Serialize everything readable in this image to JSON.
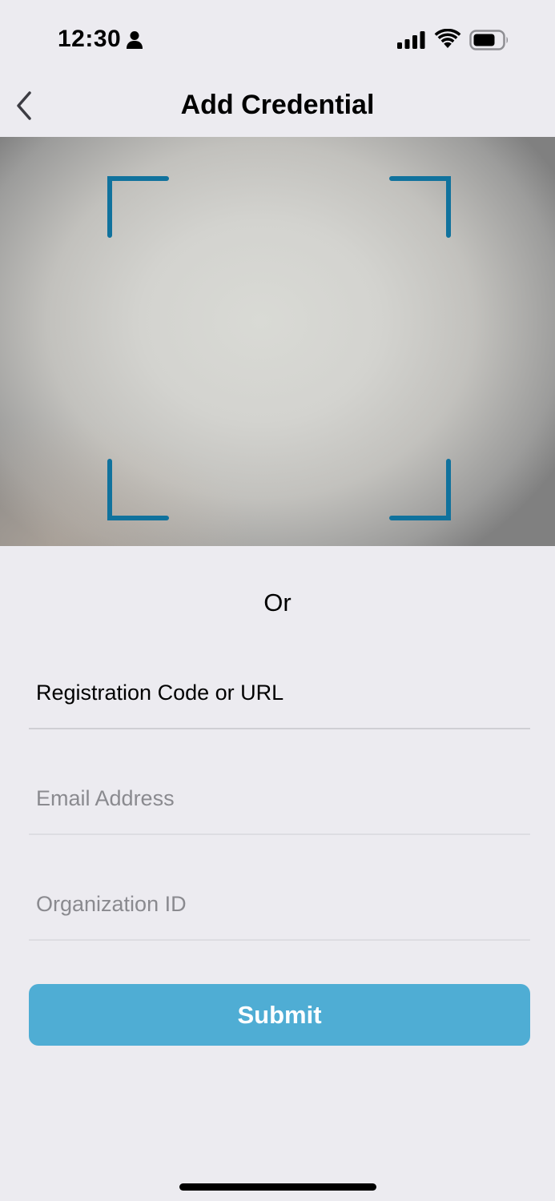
{
  "status_bar": {
    "time": "12:30",
    "icons": [
      "person-icon",
      "cellular-signal-icon",
      "wifi-icon",
      "battery-icon"
    ]
  },
  "nav": {
    "title": "Add Credential",
    "back_icon": "chevron-left-icon"
  },
  "scanner": {
    "frame_color": "#10729d",
    "frame_icon": "scan-frame-corners"
  },
  "divider_text": "Or",
  "form": {
    "registration": {
      "placeholder": "Registration Code or URL",
      "value": ""
    },
    "email": {
      "placeholder": "Email Address",
      "value": ""
    },
    "organization": {
      "placeholder": "Organization ID",
      "value": ""
    },
    "submit_label": "Submit"
  },
  "colors": {
    "background": "#ecebf0",
    "accent": "#4fadd4",
    "scan_frame": "#10729d",
    "placeholder": "#8a8a8f"
  }
}
